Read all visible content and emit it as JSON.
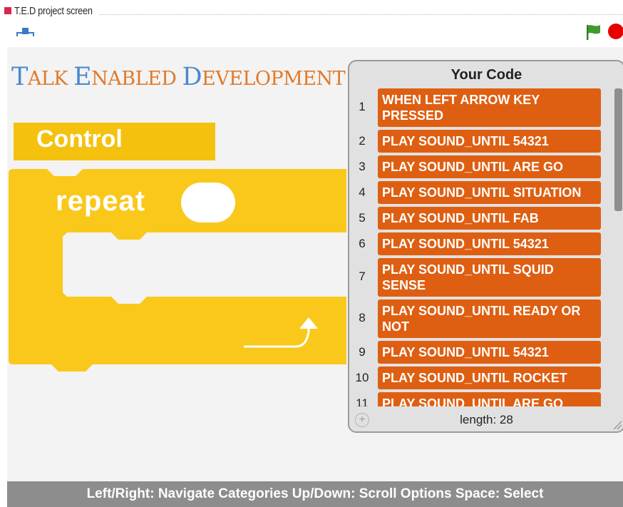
{
  "caption": {
    "text": "T.E.D project screen",
    "accent_color": "#d8264f"
  },
  "toolbar": {
    "fullscreen_icon": "fullscreen-toggle-icon",
    "green_flag_icon": "green-flag-icon",
    "stop_icon": "stop-sign-icon",
    "flag_color": "#3f9a2e",
    "stop_color": "#e60000"
  },
  "app_title": {
    "words": [
      {
        "first": "T",
        "rest": "ALK"
      },
      {
        "first": "E",
        "rest": "NABLED"
      },
      {
        "first": "D",
        "rest": "EVELOPMENT"
      }
    ],
    "colors": [
      "#4a89cf",
      "#e07a2a"
    ]
  },
  "category": {
    "label": "Control",
    "color": "#f4c20e"
  },
  "repeat_block": {
    "label": "repeat",
    "color": "#f9c81b",
    "count_value": ""
  },
  "code_panel": {
    "title": "Your Code",
    "block_color": "#de5f12",
    "lines": [
      {
        "num": "1",
        "text": "WHEN LEFT ARROW KEY PRESSED"
      },
      {
        "num": "2",
        "text": "PLAY SOUND_UNTIL 54321"
      },
      {
        "num": "3",
        "text": "PLAY SOUND_UNTIL ARE GO"
      },
      {
        "num": "4",
        "text": "PLAY SOUND_UNTIL SITUATION"
      },
      {
        "num": "5",
        "text": "PLAY SOUND_UNTIL FAB"
      },
      {
        "num": "6",
        "text": "PLAY SOUND_UNTIL 54321"
      },
      {
        "num": "7",
        "text": "PLAY SOUND_UNTIL SQUID SENSE"
      },
      {
        "num": "8",
        "text": "PLAY SOUND_UNTIL READY OR NOT"
      },
      {
        "num": "9",
        "text": "PLAY SOUND_UNTIL 54321"
      },
      {
        "num": "10",
        "text": "PLAY SOUND_UNTIL ROCKET"
      },
      {
        "num": "11",
        "text": "PLAY SOUND_UNTIL ARE GO"
      }
    ],
    "add_symbol": "+",
    "length_text": "length: 28"
  },
  "hint_bar": {
    "text": "Left/Right: Navigate Categories  Up/Down: Scroll Options  Space: Select"
  }
}
